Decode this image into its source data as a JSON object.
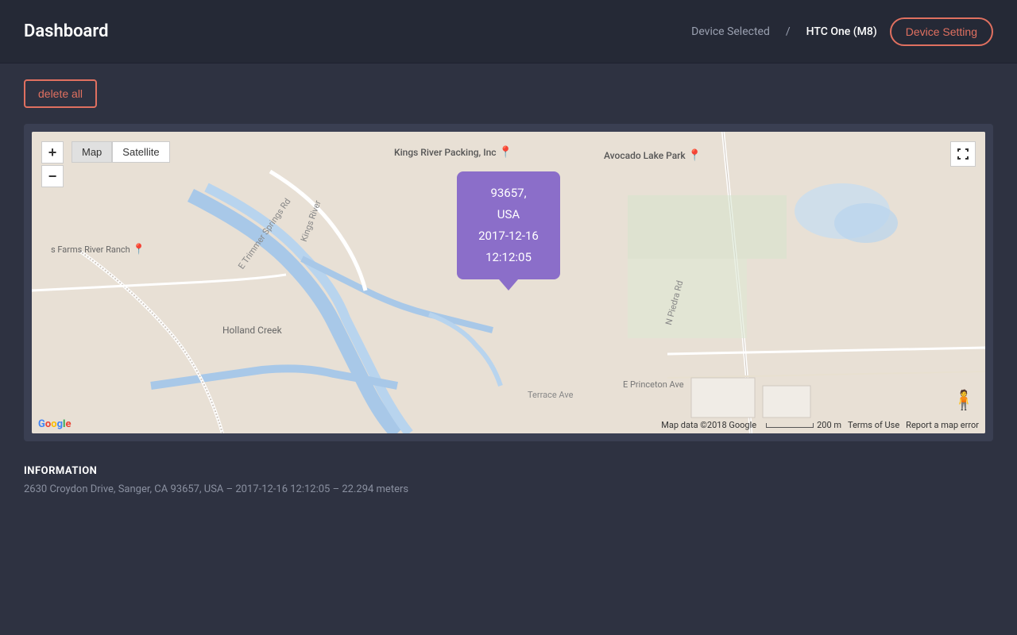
{
  "header": {
    "title": "Dashboard",
    "device_selected_label": "Device Selected",
    "separator": "/",
    "device_name": "HTC One (M8)",
    "device_setting_label": "Device Setting"
  },
  "toolbar": {
    "delete_all_label": "delete all"
  },
  "map": {
    "type_buttons": [
      "Map",
      "Satellite"
    ],
    "active_type": "Map",
    "popup": {
      "line1": "93657,",
      "line2": "USA",
      "line3": "2017-12-16",
      "line4": "12:12:05"
    },
    "attribution": "Google",
    "map_data": "Map data ©2018 Google",
    "scale_label": "200 m",
    "terms": "Terms of Use",
    "report": "Report a map error"
  },
  "information": {
    "title": "INFORMATION",
    "text": "2630 Croydon Drive, Sanger, CA 93657, USA – 2017-12-16 12:12:05 – 22.294 meters"
  }
}
